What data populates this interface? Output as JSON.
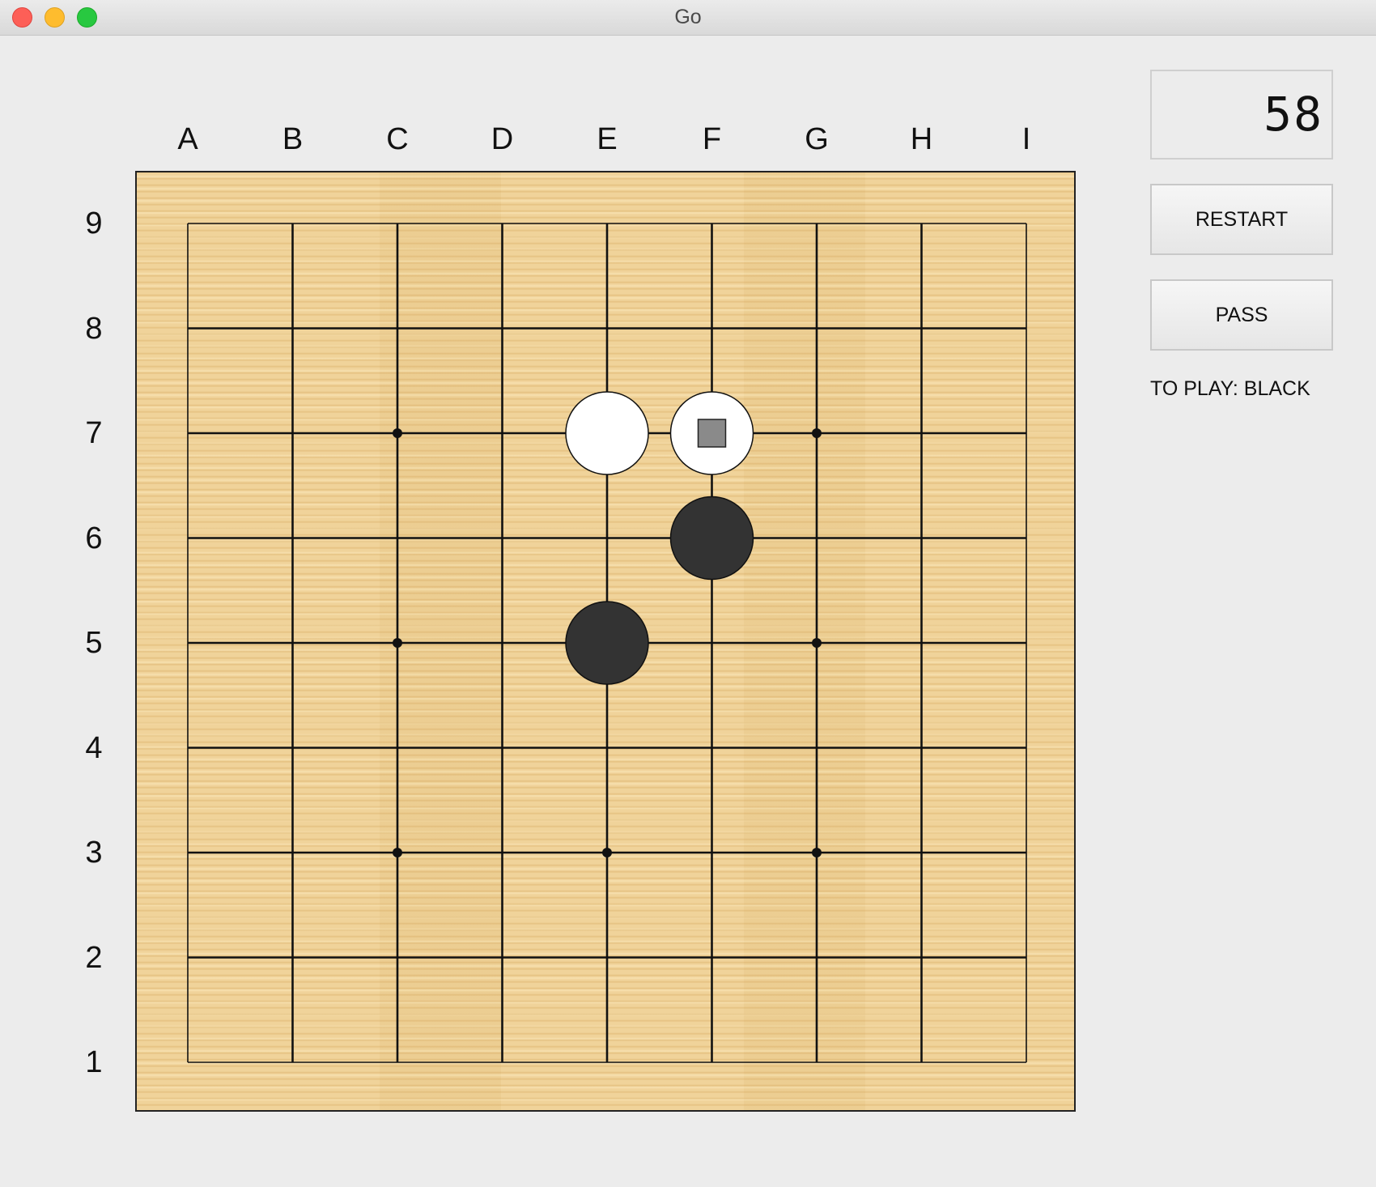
{
  "window": {
    "title": "Go"
  },
  "board": {
    "columns": [
      "A",
      "B",
      "C",
      "D",
      "E",
      "F",
      "G",
      "H",
      "I"
    ],
    "rows": [
      "9",
      "8",
      "7",
      "6",
      "5",
      "4",
      "3",
      "2",
      "1"
    ],
    "size": 9,
    "star_points": [
      "C7",
      "G7",
      "C5",
      "G5",
      "C3",
      "E3",
      "G3"
    ],
    "stones": [
      {
        "point": "E7",
        "color": "white"
      },
      {
        "point": "F7",
        "color": "white",
        "last_move_marker": true
      },
      {
        "point": "F6",
        "color": "black"
      },
      {
        "point": "E5",
        "color": "black"
      }
    ],
    "colors": {
      "wood": "#f0d39a",
      "line": "#111111",
      "black_stone": "#333333",
      "white_stone": "#ffffff",
      "marker": "#8a8a8a"
    }
  },
  "sidebar": {
    "move_counter": "58",
    "restart_label": "RESTART",
    "pass_label": "PASS",
    "status_text": "TO PLAY: BLACK"
  }
}
